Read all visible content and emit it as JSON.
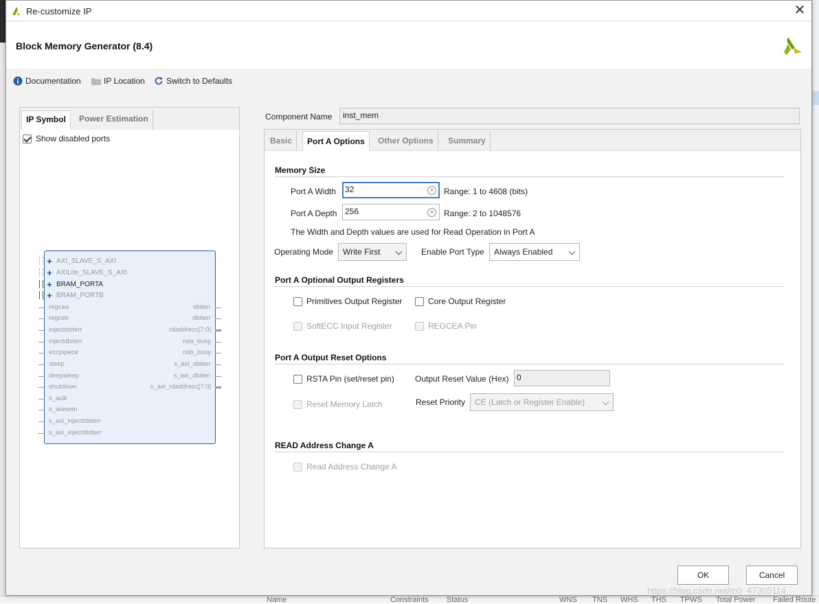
{
  "window": {
    "title": "Re-customize IP",
    "header_title": "Block Memory Generator (8.4)"
  },
  "toolbar": {
    "documentation": "Documentation",
    "ip_location": "IP Location",
    "switch_defaults": "Switch to Defaults"
  },
  "left_panel": {
    "tabs": [
      "IP Symbol",
      "Power Estimation"
    ],
    "show_disabled_ports": "Show disabled ports",
    "symbol": {
      "buses": [
        "AXI_SLAVE_S_AXI",
        "AXILite_SLAVE_S_AXI",
        "BRAM_PORTA",
        "BRAM_PORTB"
      ],
      "left_ports": [
        "regcea",
        "regceb",
        "injectsbiterr",
        "injectdbiterr",
        "eccpipece",
        "sleep",
        "deepsleep",
        "shutdown",
        "s_aclk",
        "s_aresetn",
        "s_axi_injectsbiterr",
        "s_axi_injectdbiterr"
      ],
      "right_ports": [
        "sbiterr",
        "dbiterr",
        "rdaddrecc[7:0]",
        "rsta_busy",
        "rstb_busy",
        "s_axi_sbiterr",
        "s_axi_dbiterr",
        "s_axi_rdaddrecc[7:0]"
      ]
    }
  },
  "component": {
    "label": "Component Name",
    "value": "inst_mem"
  },
  "right_tabs": [
    "Basic",
    "Port A Options",
    "Other Options",
    "Summary"
  ],
  "memory_size": {
    "title": "Memory Size",
    "width_label": "Port A Width",
    "width_value": "32",
    "width_range": "Range: 1 to 4608 (bits)",
    "depth_label": "Port A Depth",
    "depth_value": "256",
    "depth_range": "Range: 2 to 1048576",
    "note": "The Width and Depth values are used for Read Operation in Port A",
    "mode_label": "Operating Mode",
    "mode_value": "Write First",
    "enable_label": "Enable Port Type",
    "enable_value": "Always Enabled"
  },
  "optional_regs": {
    "title": "Port A Optional Output Registers",
    "primitives": "Primitives Output Register",
    "core": "Core Output Register",
    "softecc": "SoftECC Input Register",
    "regcea": "REGCEA Pin"
  },
  "reset_options": {
    "title": "Port A Output Reset Options",
    "rsta": "RSTA Pin (set/reset pin)",
    "reset_value_label": "Output Reset Value (Hex)",
    "reset_value": "0",
    "reset_latch": "Reset Memory Latch",
    "priority_label": "Reset Priority",
    "priority_value": "CE (Latch or Register Enable)"
  },
  "read_addr": {
    "title": "READ Address Change A",
    "option": "Read Address Change A"
  },
  "buttons": {
    "ok": "OK",
    "cancel": "Cancel"
  },
  "background": {
    "columns": [
      "Name",
      "Constraints",
      "Status",
      "WNS",
      "TNS",
      "WHS",
      "THS",
      "TPWS",
      "Total Power",
      "Failed Route"
    ]
  },
  "watermark": "https://blog.csdn.net/m0_47305114",
  "colors": {
    "accent": "#3c7bc8",
    "symbol_fill": "#e8f1fb",
    "symbol_border": "#2a5d9a"
  },
  "icons": {
    "documentation": "info-icon",
    "ip_location": "folder-icon",
    "switch_defaults": "refresh-icon"
  }
}
